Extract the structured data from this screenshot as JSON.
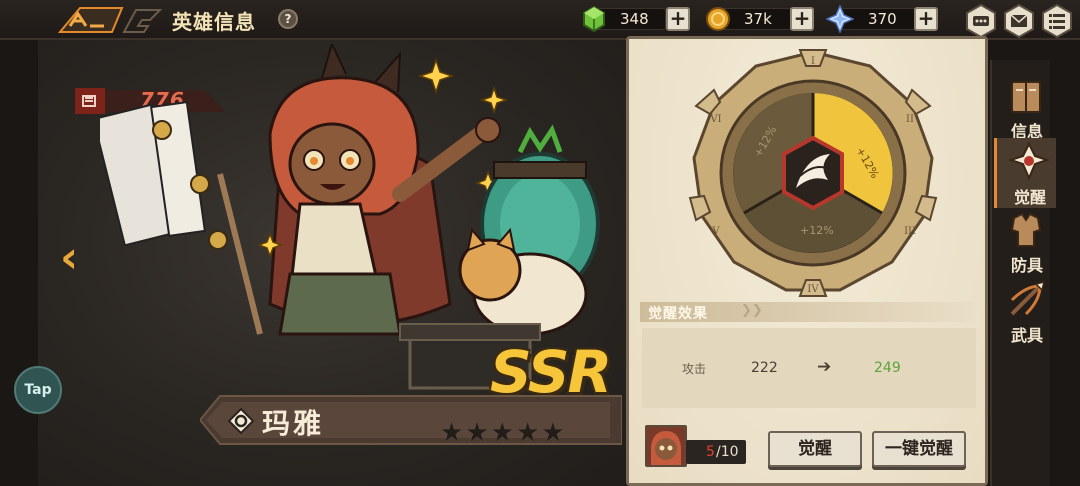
{
  "header": {
    "title": "英雄信息",
    "help_label": "?"
  },
  "resources": [
    {
      "icon": "green-gem-icon",
      "value": "348",
      "add_label": "+"
    },
    {
      "icon": "gold-coin-icon",
      "value": "37k",
      "add_label": "+"
    },
    {
      "icon": "crystal-icon",
      "value": "370",
      "add_label": "+"
    }
  ],
  "hero": {
    "power": "776",
    "name": "玛雅",
    "rarity": "SSR",
    "stars": [
      "★",
      "★",
      "★",
      "★",
      "★"
    ]
  },
  "nav": {
    "prev": "‹",
    "next": "›",
    "tap": "Tap"
  },
  "awakening": {
    "dial_roman": [
      "I",
      "II",
      "III",
      "IV",
      "V",
      "VI"
    ],
    "segments": [
      "+12%",
      "+12%",
      "+12%"
    ],
    "effects_title": "觉醒效果",
    "effects_chevrons": "❯❯",
    "stat": {
      "label": "攻击",
      "from": "222",
      "arrow": "➔",
      "to": "249"
    },
    "count_current": "5",
    "count_max": "/10",
    "awaken_label": "觉醒",
    "awaken_all_label": "一键觉醒"
  },
  "side_tabs": [
    {
      "label": "信息",
      "icon": "book-icon",
      "active": false
    },
    {
      "label": "觉醒",
      "icon": "awaken-emblem-icon",
      "active": true
    },
    {
      "label": "防具",
      "icon": "armor-icon",
      "active": false
    },
    {
      "label": "武具",
      "icon": "crossbow-icon",
      "active": false
    }
  ],
  "colors": {
    "accent_orange": "#e48a35",
    "gold": "#f7c53a",
    "stat_up": "#5ca338",
    "count_red": "#e0412f",
    "panel_bg": "#efe6d1"
  }
}
